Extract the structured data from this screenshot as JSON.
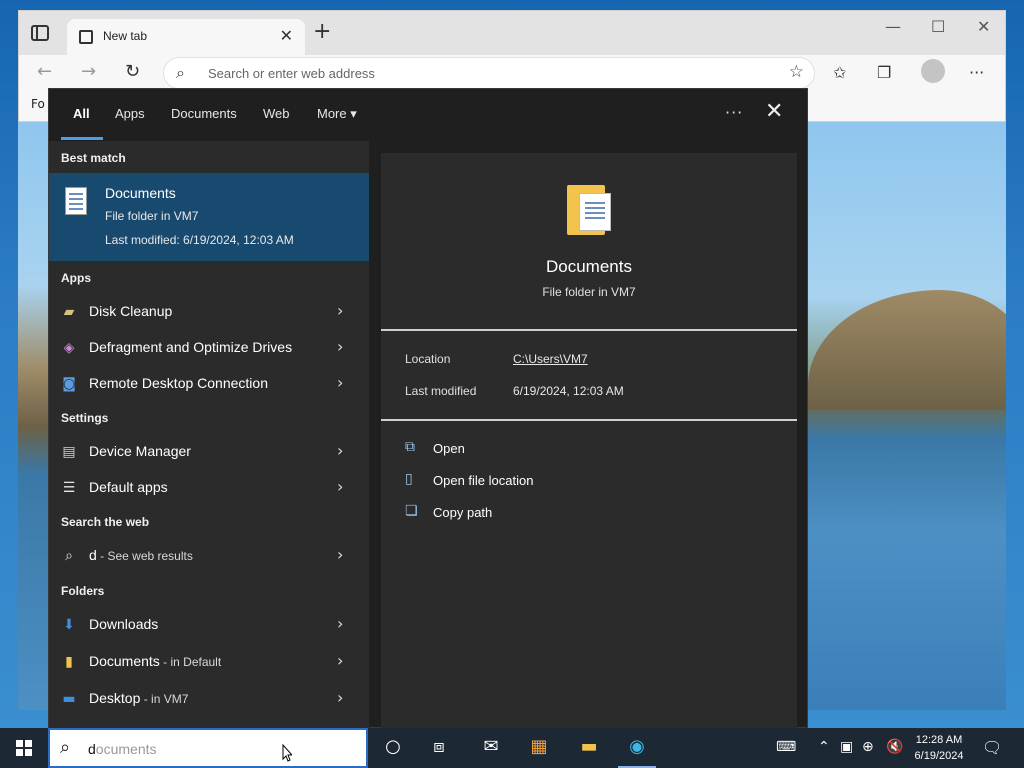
{
  "browser": {
    "tab_title": "New tab",
    "tab_close": "✕",
    "new_tab": "+",
    "minimize": "—",
    "maximize": "☐",
    "close": "✕",
    "back": "←",
    "forward": "→",
    "refresh": "↻",
    "address_placeholder": "Search or enter web address",
    "favorites_bar_text": "Fo",
    "more": "···"
  },
  "search_panel": {
    "filters": [
      "All",
      "Apps",
      "Documents",
      "Web",
      "More ▾"
    ],
    "active_filter": "All",
    "options": "···",
    "close": "✕",
    "best_match": {
      "header": "Best match",
      "title": "Documents",
      "subtitle": "File folder in VM7",
      "modified": "Last modified: 6/19/2024, 12:03 AM"
    },
    "apps": {
      "header": "Apps",
      "items": [
        "Disk Cleanup",
        "Defragment and Optimize Drives",
        "Remote Desktop Connection"
      ]
    },
    "settings": {
      "header": "Settings",
      "items": [
        "Device Manager",
        "Default apps"
      ]
    },
    "web": {
      "header": "Search the web",
      "query": "d",
      "suffix": " - See web results"
    },
    "folders": {
      "header": "Folders",
      "items": [
        {
          "name": "Downloads",
          "location": ""
        },
        {
          "name": "Documents",
          "location": " - in Default"
        },
        {
          "name": "Desktop",
          "location": " - in VM7"
        }
      ]
    },
    "chevron": "›",
    "preview": {
      "title": "Documents",
      "subtitle": "File folder in VM7",
      "location_label": "Location",
      "location_value": "C:\\Users\\VM7",
      "modified_label": "Last modified",
      "modified_value": "6/19/2024, 12:03 AM",
      "actions": [
        "Open",
        "Open file location",
        "Copy path"
      ]
    }
  },
  "taskbar": {
    "search_typed": "d",
    "search_ghost": "ocuments",
    "time": "12:28 AM",
    "date": "6/19/2024"
  },
  "colors": {
    "accent": "#4aa0e6",
    "best_match_bg": "#184a70",
    "panel_bg": "#2b2b2b",
    "taskbar_bg": "#1c2833"
  }
}
